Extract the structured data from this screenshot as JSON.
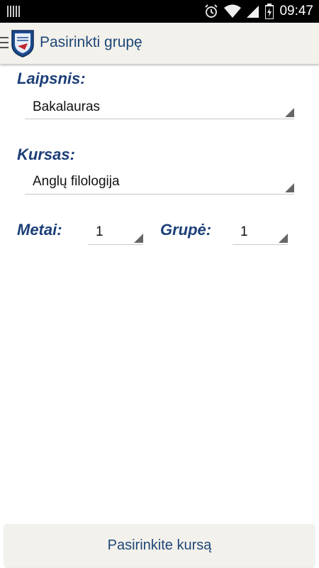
{
  "status_bar": {
    "time": "09:47",
    "icons": [
      "notification-bars-icon",
      "alarm-icon",
      "wifi-icon",
      "signal-icon",
      "battery-icon"
    ]
  },
  "action_bar": {
    "title": "Pasirinkti grupę",
    "icons": [
      "menu-icon",
      "university-logo"
    ]
  },
  "form": {
    "degree_label": "Laipsnis:",
    "degree_value": "Bakalauras",
    "course_label": "Kursas:",
    "course_value": "Anglų filologija",
    "year_label": "Metai:",
    "year_value": "1",
    "group_label": "Grupė:",
    "group_value": "1"
  },
  "bottom_button": {
    "label": "Pasirinkite kursą"
  },
  "colors": {
    "accent": "#1c3f78",
    "bar_background": "#f3f1eb",
    "status_bar": "#000000"
  }
}
